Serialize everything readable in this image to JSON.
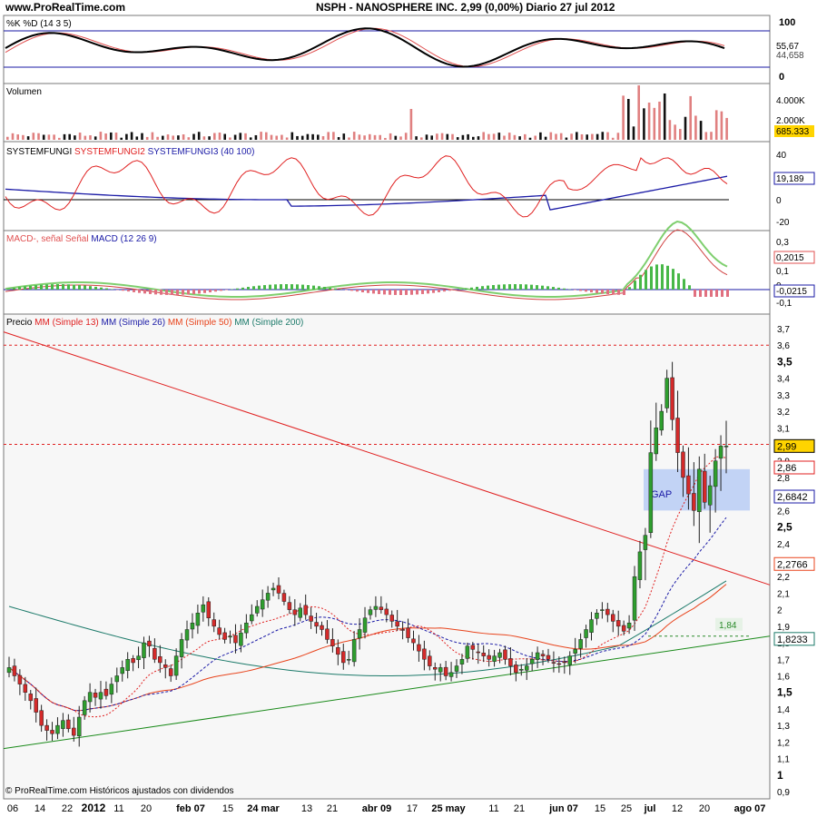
{
  "header": {
    "site": "www.ProRealTime.com",
    "title": "NSPH - NANOSPHERE INC.    2,99 (0,00%)    Diario  27 jul 2012"
  },
  "colors": {
    "candle_up": "#2e9e2e",
    "candle_down": "#d42a2a",
    "mm13": "#e02020",
    "mm26": "#1a1aa6",
    "mm50": "#e8441c",
    "mm200": "#1c7a6a",
    "trend_up": "#1a8a1a",
    "trend_down": "#e02020",
    "gap_box": "#b8ccf4",
    "price_tag": "#ffd400",
    "volume_bar_up": "#e08080",
    "volume_bar_down": "#111111"
  },
  "x_axis": {
    "labels": [
      "06",
      "14",
      "22",
      "2012",
      "11",
      "20",
      "feb 07",
      "15",
      "24 mar",
      "13",
      "21",
      "abr 09",
      "17",
      "25 may",
      "11",
      "21",
      "jun 07",
      "15",
      "25",
      "jul",
      "12",
      "20",
      "ago 07"
    ]
  },
  "panels": {
    "stoch": {
      "title": "%K %D (14 3 5)",
      "ticks": [
        "100",
        "0"
      ],
      "last_values": [
        "55,67",
        "44,658"
      ]
    },
    "volume": {
      "title": "Volumen",
      "ticks": [
        "4.000K",
        "2.000K"
      ],
      "last_value": "685.333"
    },
    "fungi": {
      "title_black": "SYSTEMFUNGI",
      "title_red": "SYSTEMFUNGI2",
      "title_blue": "SYSTEMFUNGI3 (40 100)",
      "ticks": [
        "40",
        "0",
        "-20"
      ],
      "last_value": "19,189"
    },
    "macd": {
      "title_red": "MACD-, señal Señal",
      "title_blue": "MACD (12 26 9)",
      "ticks": [
        "0,3",
        "0,2",
        "0,1",
        "0",
        "-0,1"
      ],
      "last_values": [
        "0,2015",
        "-0,0215"
      ]
    },
    "price": {
      "title_black": "Precio",
      "title_mm13": "MM (Simple 13)",
      "title_mm26": "MM (Simple 26)",
      "title_mm50": "MM (Simple 50)",
      "title_mm200": "MM (Simple 200)",
      "gap_label": "GAP",
      "level_label": "1,84",
      "tags": [
        "2,99",
        "2,86",
        "2,6842",
        "2,2766",
        "1,8233"
      ],
      "footer": "© ProRealTime.com  Históricos ajustados con dividendos"
    }
  },
  "chart_data": {
    "type": "candlestick",
    "title": "NSPH - NANOSPHERE INC.",
    "last_close": 2.99,
    "change": "0,00%",
    "date": "27 jul 2012",
    "ylim": [
      0.9,
      3.8
    ],
    "y_ticks": [
      "3,7",
      "3,6",
      "3,5",
      "3,4",
      "3,3",
      "3,2",
      "3,1",
      "3",
      "2,9",
      "2,8",
      "2,7",
      "2,6",
      "2,5",
      "2,4",
      "2,3",
      "2,2",
      "2,1",
      "2",
      "1,9",
      "1,8",
      "1,7",
      "1,6",
      "1,5",
      "1,4",
      "1,3",
      "1,2",
      "1,1",
      "1",
      "0,9"
    ],
    "bold_ticks": [
      "3,5",
      "2,5",
      "1,5",
      "1"
    ],
    "close": [
      1.65,
      1.6,
      1.55,
      1.5,
      1.45,
      1.38,
      1.3,
      1.27,
      1.25,
      1.3,
      1.33,
      1.28,
      1.24,
      1.35,
      1.45,
      1.5,
      1.47,
      1.5,
      1.48,
      1.55,
      1.6,
      1.65,
      1.7,
      1.68,
      1.72,
      1.8,
      1.78,
      1.7,
      1.68,
      1.65,
      1.6,
      1.72,
      1.82,
      1.88,
      1.92,
      1.98,
      2.03,
      1.95,
      1.9,
      1.85,
      1.82,
      1.84,
      1.8,
      1.86,
      1.92,
      1.97,
      2.02,
      2.06,
      2.1,
      2.13,
      2.1,
      2.05,
      2.0,
      1.97,
      2.01,
      1.97,
      1.93,
      1.9,
      1.88,
      1.82,
      1.78,
      1.73,
      1.68,
      1.7,
      1.82,
      1.88,
      1.95,
      2.0,
      2.02,
      2.0,
      1.97,
      1.93,
      1.9,
      1.88,
      1.83,
      1.8,
      1.75,
      1.7,
      1.66,
      1.64,
      1.65,
      1.6,
      1.62,
      1.66,
      1.7,
      1.78,
      1.76,
      1.74,
      1.72,
      1.7,
      1.72,
      1.74,
      1.7,
      1.66,
      1.62,
      1.64,
      1.66,
      1.7,
      1.74,
      1.72,
      1.7,
      1.68,
      1.67,
      1.68,
      1.72,
      1.76,
      1.82,
      1.88,
      1.94,
      1.98,
      2.0,
      1.97,
      1.93,
      1.9,
      1.87,
      1.92,
      2.2,
      2.35,
      2.45,
      2.95,
      3.1,
      3.2,
      3.4,
      3.15,
      2.95,
      2.8,
      2.7,
      2.6,
      2.85,
      2.65,
      2.75,
      2.9,
      2.99,
      2.99
    ],
    "series": [
      {
        "name": "MM (Simple 13)",
        "y_start": 1.48,
        "y_end": 2.92
      },
      {
        "name": "MM (Simple 26)",
        "y_start": 1.53,
        "y_end": 2.68
      },
      {
        "name": "MM (Simple 50)",
        "y_start": 1.4,
        "y_end": 2.28
      },
      {
        "name": "MM (Simple 200)",
        "y_start": 2.02,
        "y_end": 1.82
      }
    ],
    "trendlines": [
      {
        "name": "down",
        "from": [
          0,
          3.68
        ],
        "to": [
          139,
          2.15
        ]
      },
      {
        "name": "up",
        "from": [
          0,
          1.16
        ],
        "to": [
          139,
          1.84
        ]
      }
    ],
    "levels": [
      3.6,
      3.0,
      1.84
    ],
    "gap": [
      2.6,
      2.85
    ]
  }
}
